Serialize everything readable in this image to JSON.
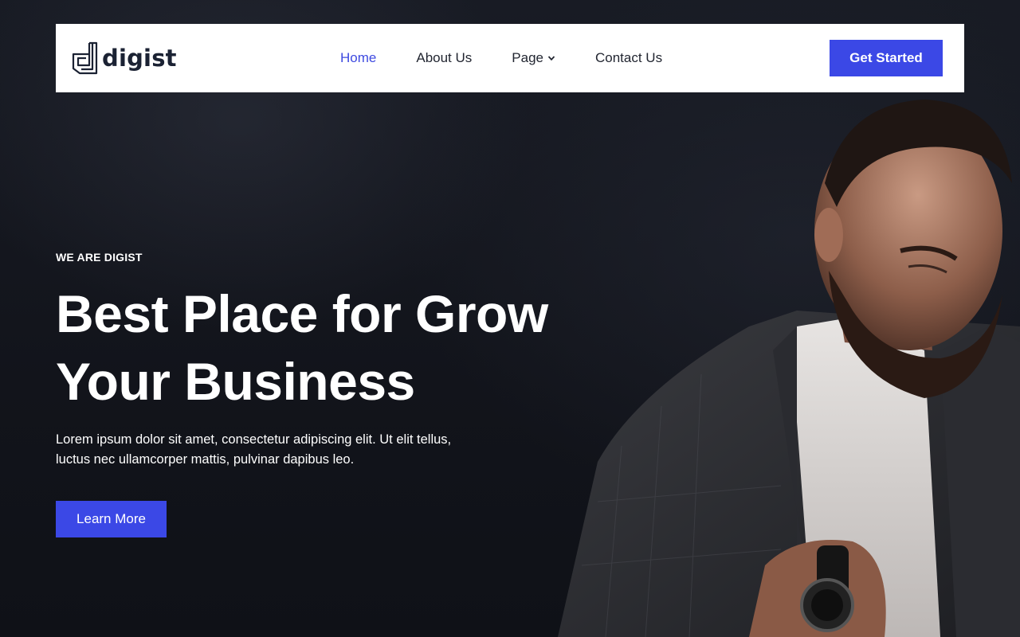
{
  "brand": {
    "name": "digist"
  },
  "nav": {
    "links": [
      {
        "label": "Home",
        "active": true
      },
      {
        "label": "About Us",
        "active": false
      },
      {
        "label": "Page",
        "active": false,
        "dropdown": true
      },
      {
        "label": "Contact Us",
        "active": false
      }
    ],
    "cta_label": "Get Started"
  },
  "hero": {
    "eyebrow": "WE ARE DIGIST",
    "headline_line1": "Best Place for Grow",
    "headline_line2": "Your Business",
    "description_line1": "Lorem ipsum dolor sit amet, consectetur adipiscing elit. Ut elit tellus,",
    "description_line2": "luctus nec ullamcorper mattis, pulvinar dapibus leo.",
    "cta_label": "Learn More"
  },
  "colors": {
    "accent": "#3b48e6",
    "nav_active": "#3e4ae0",
    "background": "#13151d",
    "navbar_bg": "#ffffff",
    "brand_text": "#1b2233"
  },
  "icons": {
    "logo": "digist-logo-icon",
    "dropdown": "chevron-down-icon"
  }
}
